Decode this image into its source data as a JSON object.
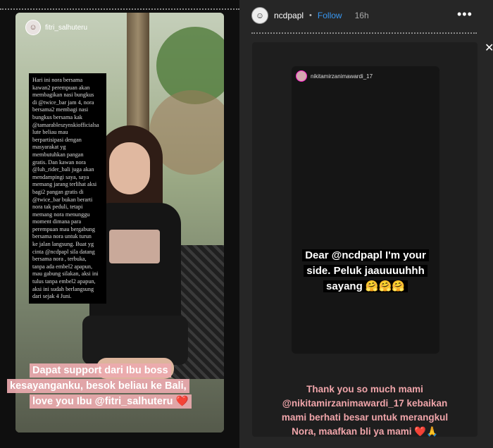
{
  "left_story": {
    "username": "fitri_salhuteru",
    "caption_lines": [
      "Hari ini nora bersama",
      "kawan2 perempuan akan",
      "membagikan nasi bungkus",
      "di @twice_bar jam 4, nora",
      "bersama2 membagi nasi",
      "bungkus bersama kak",
      "@tamarableszynskiofficialsa",
      "lute beliau mau",
      "berpartisipasi dengan",
      "masyarakat yg",
      "membutuhkan pangan",
      "gratis. Dan kawan nora",
      "@luh_rider_bali juga akan",
      "mendampingi saya, saya",
      "memang jarang terlihat aksi",
      "bagi2 pangan gratis di",
      "@twice_bar bukan berarti",
      "nora tak peduli, tetapi",
      "memang nora menunggu",
      "moment dimana para",
      "perempuan mau bergabung",
      "bersama nora untuk turun",
      "ke jalan langsung. Buat yg",
      "cinta @ncdpapl sila datang",
      "bersama nora , terbuka,",
      "tanpa ada embel2 apapun,",
      "mau gabung silakan, aksi ini",
      "tulus tanpa embel2 apapun,",
      "aksi ini sudah berlangsung",
      "dari sejak 4 Juni."
    ],
    "pink_lines": [
      "Dapat support dari Ibu boss",
      "kesayanganku, besok beliau ke Bali,",
      "love you Ibu @fitri_salhuteru ❤️"
    ]
  },
  "right_story": {
    "username": "ncdpapl",
    "separator": "•",
    "follow_label": "Follow",
    "time": "16h",
    "more_label": "•••",
    "close_label": "✕",
    "inner_username": "nikitamirzanimawardi_17",
    "dear_text": "Dear @ncdpapl I'm your side. Peluk jaauuuuhhh sayang 🤗🤗🤗",
    "thanks_lines": [
      "Thank you so much mami",
      "@nikitamirzanimawardi_17 kebaikan",
      "mami berhati besar untuk merangkul",
      "Nora, maafkan bli ya mami ❤️🙏"
    ]
  },
  "colors": {
    "follow": "#3897f0",
    "pink_caption": "#f0a5aa",
    "pink_box": "#ebaaaf"
  }
}
